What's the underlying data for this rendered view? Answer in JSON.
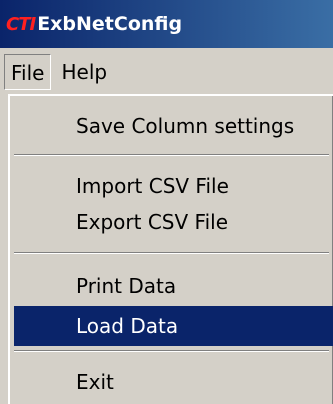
{
  "window": {
    "logo_text": "CTI",
    "title": "ExbNetConfig"
  },
  "menubar": {
    "items": [
      {
        "label": "File",
        "open": true
      },
      {
        "label": "Help",
        "open": false
      }
    ]
  },
  "file_menu": {
    "items": [
      {
        "label": "Save Column settings",
        "selected": false
      },
      {
        "label": "Import CSV File",
        "selected": false
      },
      {
        "label": "Export CSV File",
        "selected": false
      },
      {
        "label": "Print Data",
        "selected": false
      },
      {
        "label": "Load Data",
        "selected": true
      },
      {
        "label": "Exit",
        "selected": false
      }
    ]
  },
  "colors": {
    "title_bar": "#0a246a",
    "logo": "#ff2020",
    "selection": "#0a246a",
    "menu_bg": "#d4d0c8"
  }
}
